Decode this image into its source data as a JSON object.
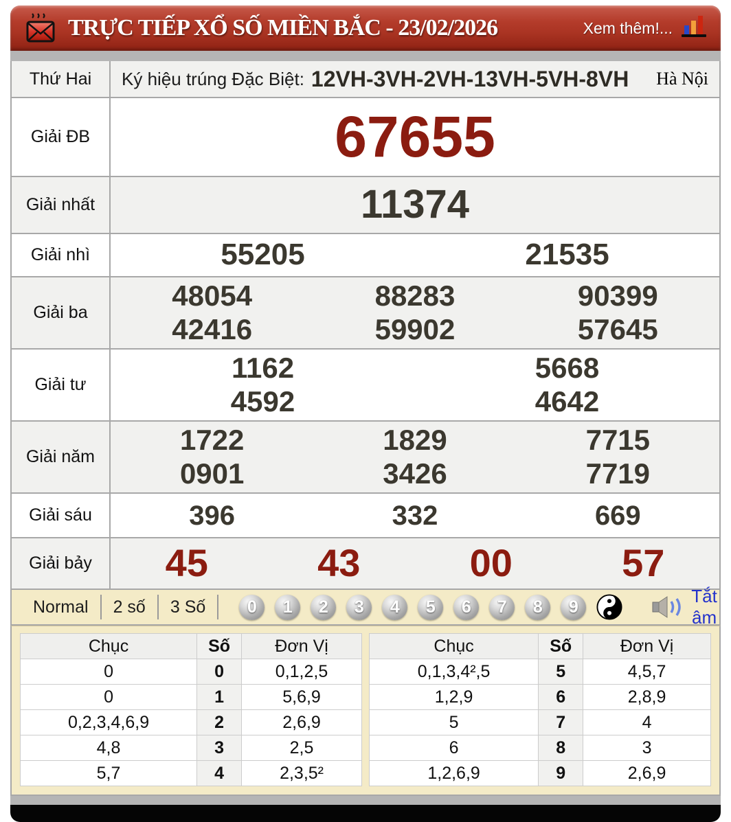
{
  "header": {
    "title": "TRỰC TIẾP XỔ SỐ MIỀN BẮC - 23/02/2026",
    "more_label": "Xem thêm!..."
  },
  "info_row": {
    "day": "Thứ Hai",
    "sign_label": "Ký hiệu trúng Đặc Biệt:",
    "sign_value": "12VH-3VH-2VH-13VH-5VH-8VH",
    "region": "Hà Nội"
  },
  "prizes": [
    {
      "id": "db",
      "label": "Giải ĐB",
      "rows": [
        [
          "67655"
        ]
      ]
    },
    {
      "id": "nhat",
      "label": "Giải nhất",
      "rows": [
        [
          "11374"
        ]
      ]
    },
    {
      "id": "nhi",
      "label": "Giải nhì",
      "rows": [
        [
          "55205",
          "21535"
        ]
      ]
    },
    {
      "id": "ba",
      "label": "Giải ba",
      "rows": [
        [
          "48054",
          "88283",
          "90399"
        ],
        [
          "42416",
          "59902",
          "57645"
        ]
      ]
    },
    {
      "id": "tu",
      "label": "Giải tư",
      "rows": [
        [
          "1162",
          "5668"
        ],
        [
          "4592",
          "4642"
        ]
      ]
    },
    {
      "id": "nam",
      "label": "Giải năm",
      "rows": [
        [
          "1722",
          "1829",
          "7715"
        ],
        [
          "0901",
          "3426",
          "7719"
        ]
      ]
    },
    {
      "id": "sau",
      "label": "Giải sáu",
      "rows": [
        [
          "396",
          "332",
          "669"
        ]
      ]
    },
    {
      "id": "bay",
      "label": "Giải bảy",
      "rows": [
        [
          "45",
          "43",
          "00",
          "57"
        ]
      ]
    }
  ],
  "toolbar": {
    "modes": [
      "Normal",
      "2 số",
      "3 Số"
    ],
    "digits": [
      "0",
      "1",
      "2",
      "3",
      "4",
      "5",
      "6",
      "7",
      "8",
      "9"
    ],
    "mute_label": "Tắt âm"
  },
  "digit_tables": {
    "headers": [
      "Chục",
      "Số",
      "Đơn Vị"
    ],
    "left": [
      {
        "chuc": "0",
        "so": "0",
        "donvi": "0,1,2,5"
      },
      {
        "chuc": "0",
        "so": "1",
        "donvi": "5,6,9"
      },
      {
        "chuc": "0,2,3,4,6,9",
        "so": "2",
        "donvi": "2,6,9"
      },
      {
        "chuc": "4,8",
        "so": "3",
        "donvi": "2,5"
      },
      {
        "chuc": "5,7",
        "so": "4",
        "donvi": "2,3,5²"
      }
    ],
    "right": [
      {
        "chuc": "0,1,3,4²,5",
        "so": "5",
        "donvi": "4,5,7"
      },
      {
        "chuc": "1,2,9",
        "so": "6",
        "donvi": "2,8,9"
      },
      {
        "chuc": "5",
        "so": "7",
        "donvi": "4"
      },
      {
        "chuc": "6",
        "so": "8",
        "donvi": "3"
      },
      {
        "chuc": "1,2,6,9",
        "so": "9",
        "donvi": "2,6,9"
      }
    ]
  },
  "colors": {
    "header_red": "#a93322",
    "prize_red": "#8b1c10",
    "number_dark": "#3b382f",
    "toolbar_cream": "#f4ebc7",
    "mute_blue": "#2433cc"
  }
}
